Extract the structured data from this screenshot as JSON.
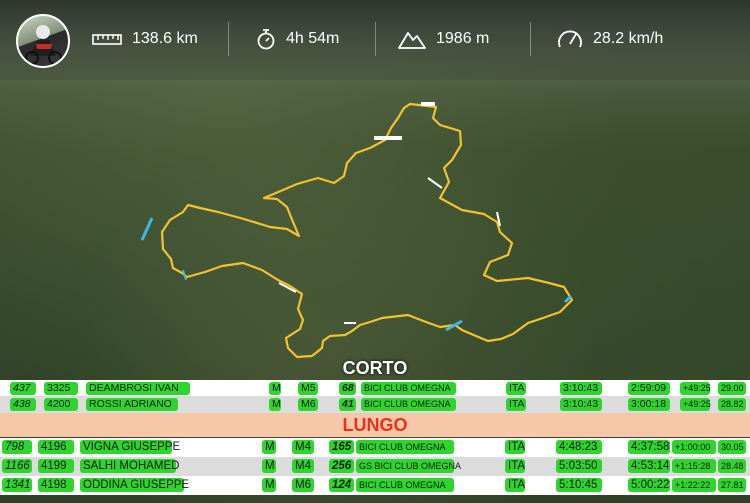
{
  "stats": {
    "distance": "138.6 km",
    "duration": "4h 54m",
    "elevation": "1986 m",
    "speed": "28.2 km/h"
  },
  "icons": {
    "avatar": "rider-avatar",
    "distance": "ruler-icon",
    "duration": "stopwatch-icon",
    "elevation": "mountain-icon",
    "speed": "speedometer-icon"
  },
  "colors": {
    "route": "#f2c230",
    "cell": "#2fd42f",
    "lungo_band": "#f6c8a8",
    "lungo_text": "#e8321e"
  },
  "corto": {
    "title": "CORTO",
    "rows": [
      {
        "pos": "437",
        "bib": "3325",
        "name": "DEAMBROSI IVAN",
        "sex": "M",
        "cat": "M5",
        "cat_pos": "68",
        "team": "BICI CLUB OMEGNA",
        "nat": "ITA",
        "time": "3:10:43",
        "net": "2:59:09",
        "gap": "+49:25",
        "speed": "29.00"
      },
      {
        "pos": "438",
        "bib": "4200",
        "name": "ROSSI ADRIANO",
        "sex": "M",
        "cat": "M6",
        "cat_pos": "41",
        "team": "BICI CLUB OMEGNA",
        "nat": "ITA",
        "time": "3:10:43",
        "net": "3:00:18",
        "gap": "+49:25",
        "speed": "28.82"
      }
    ]
  },
  "lungo": {
    "title": "LUNGO",
    "rows": [
      {
        "pos": "798",
        "bib": "4196",
        "name": "VIGNA GIUSEPPE",
        "sex": "M",
        "cat": "M4",
        "cat_pos": "165",
        "team": "BICI CLUB OMEGNA",
        "nat": "ITA",
        "time": "4:48:23",
        "net": "4:37:58",
        "gap": "+1:00:00",
        "speed": "30.05"
      },
      {
        "pos": "1166",
        "bib": "4199",
        "name": "SALHI MOHAMED",
        "sex": "M",
        "cat": "M4",
        "cat_pos": "256",
        "team": "GS BICI CLUB OMEGNA",
        "nat": "ITA",
        "time": "5:03:50",
        "net": "4:53:14",
        "gap": "+1:15:28",
        "speed": "28.48"
      },
      {
        "pos": "1341",
        "bib": "4198",
        "name": "ODDINA GIUSEPPE",
        "sex": "M",
        "cat": "M6",
        "cat_pos": "124",
        "team": "BICI CLUB OMEGNA",
        "nat": "ITA",
        "time": "5:10:45",
        "net": "5:00:22",
        "gap": "+1:22:22",
        "speed": "27.81"
      }
    ]
  }
}
